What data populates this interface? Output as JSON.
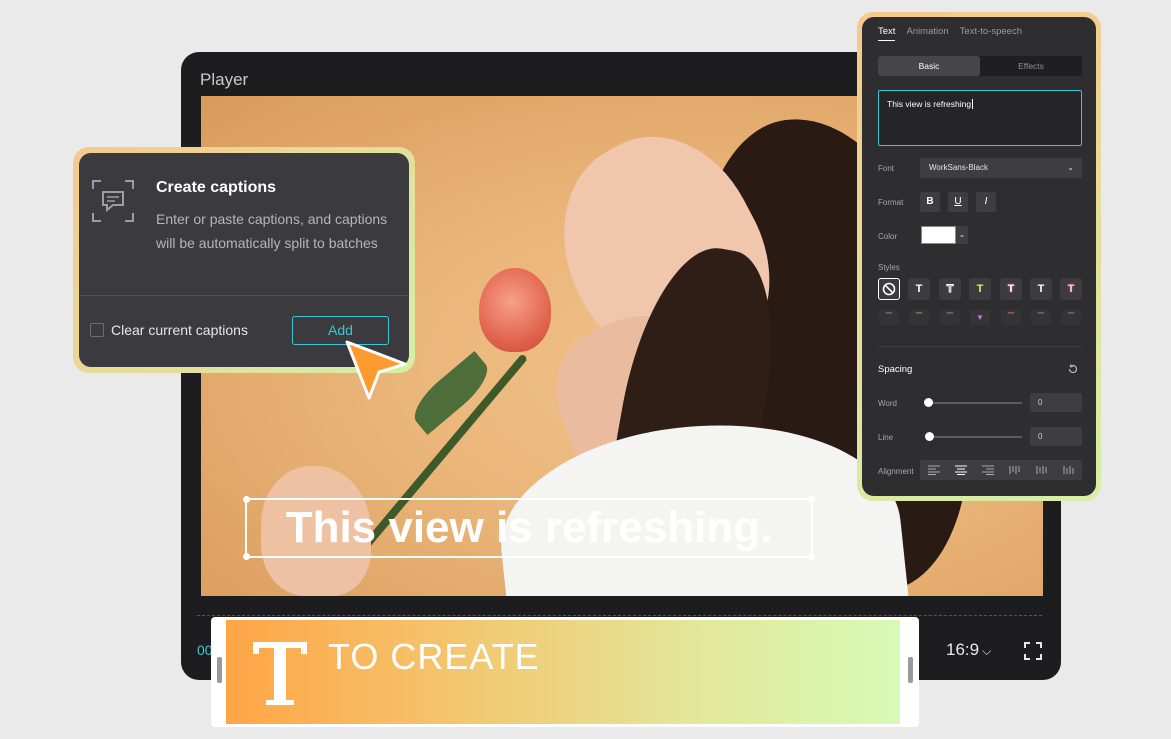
{
  "player": {
    "title": "Player",
    "caption_text": "This view is refreshing.",
    "time": "00",
    "aspect_ratio": "16:9",
    "aspect_chevron": "⌵"
  },
  "create_captions": {
    "title": "Create captions",
    "description": "Enter or paste captions, and captions will be automatically split to batches",
    "checkbox_label": "Clear current captions",
    "add_label": "Add"
  },
  "text_panel": {
    "tabs": [
      "Text",
      "Animation",
      "Text-to-speech"
    ],
    "segments": [
      "Basic",
      "Effects"
    ],
    "text_value": "This view is refreshing",
    "font_label": "Font",
    "font_value": "WorkSans-Black",
    "format_label": "Format",
    "format_buttons": [
      "B",
      "U",
      "I"
    ],
    "color_label": "Color",
    "color_value": "#ffffff",
    "styles_label": "Styles",
    "style_glyph": "T",
    "spacing_title": "Spacing",
    "word_label": "Word",
    "word_value": "0",
    "line_label": "Line",
    "line_value": "0",
    "alignment_label": "Alignment"
  },
  "banner": {
    "text": "TO CREATE"
  },
  "colors": {
    "accent": "#3bc7d6",
    "cursor": "#ff9a2e"
  }
}
